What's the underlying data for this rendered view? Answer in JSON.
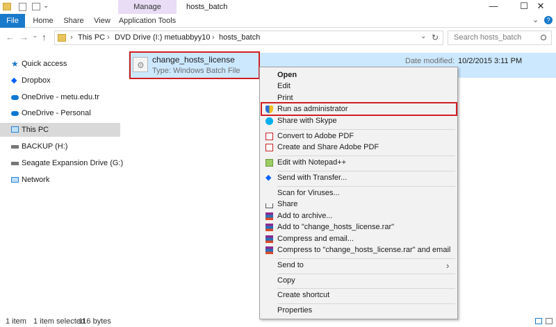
{
  "titlebar": {
    "context_tab": "Manage",
    "window_title": "hosts_batch",
    "minimize": "—",
    "maximize": "☐",
    "close": "✕"
  },
  "ribbon": {
    "tabs": [
      {
        "label": "File"
      },
      {
        "label": "Home"
      },
      {
        "label": "Share"
      },
      {
        "label": "View"
      },
      {
        "label": "Application Tools"
      }
    ],
    "expand": "⌄",
    "help": "?"
  },
  "address": {
    "back": "←",
    "forward": "→",
    "recent": "⌄",
    "up": "↑",
    "breadcrumb": [
      "This PC",
      "DVD Drive (I:) metuabbyy10",
      "hosts_batch"
    ],
    "separator": "›",
    "dropdown": "⌄",
    "refresh": "↻",
    "search_placeholder": "Search hosts_batch"
  },
  "nav": {
    "items": [
      {
        "label": "Quick access",
        "icon": "star-icon"
      },
      {
        "label": "Dropbox",
        "icon": "dropbox-icon"
      },
      {
        "label": "OneDrive - metu.edu.tr",
        "icon": "cloud-icon"
      },
      {
        "label": "OneDrive - Personal",
        "icon": "cloud-icon"
      },
      {
        "label": "This PC",
        "icon": "monitor-icon"
      },
      {
        "label": "BACKUP (H:)",
        "icon": "drive-icon"
      },
      {
        "label": "Seagate Expansion Drive (G:)",
        "icon": "drive-icon"
      },
      {
        "label": "Network",
        "icon": "network-icon"
      }
    ]
  },
  "file": {
    "name": "change_hosts_license",
    "type_label": "Type: Windows Batch File",
    "date_label": "Date modified:",
    "date_value": "10/2/2015 3:11 PM"
  },
  "context_menu": {
    "items": [
      {
        "label": "Open"
      },
      {
        "label": "Edit"
      },
      {
        "label": "Print"
      },
      {
        "label": "Run as administrator"
      },
      {
        "label": "Share with Skype"
      },
      {
        "label": "Convert to Adobe PDF"
      },
      {
        "label": "Create and Share Adobe PDF"
      },
      {
        "label": "Edit with Notepad++"
      },
      {
        "label": "Send with Transfer..."
      },
      {
        "label": "Scan for Viruses..."
      },
      {
        "label": "Share"
      },
      {
        "label": "Add to archive..."
      },
      {
        "label": "Add to \"change_hosts_license.rar\""
      },
      {
        "label": "Compress and email..."
      },
      {
        "label": "Compress to \"change_hosts_license.rar\" and email"
      },
      {
        "label": "Send to"
      },
      {
        "label": "Copy"
      },
      {
        "label": "Create shortcut"
      },
      {
        "label": "Properties"
      }
    ],
    "submenu_arrow": "›"
  },
  "status": {
    "count": "1 item",
    "selected": "1 item selected",
    "size": "116 bytes"
  },
  "colors": {
    "selection": "#cce8ff",
    "highlight_box": "#d21d22",
    "context_tab_bg": "#e9dcf5",
    "file_tab_bg": "#1979ca"
  }
}
